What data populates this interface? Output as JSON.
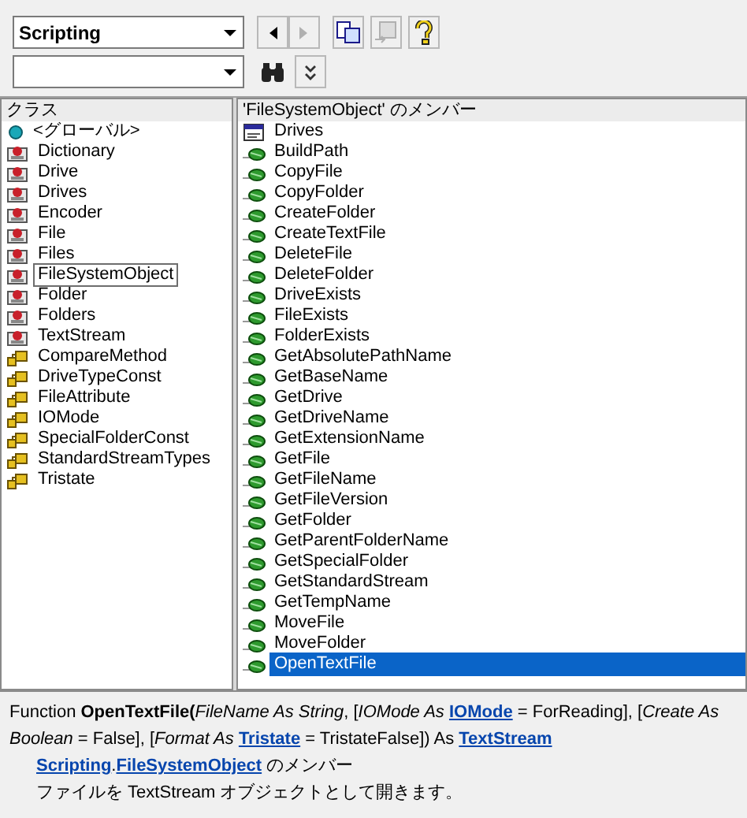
{
  "toolbar": {
    "library": {
      "value": "Scripting"
    },
    "buttons": [
      {
        "kind": "back",
        "disabled": false
      },
      {
        "kind": "forward",
        "disabled": true
      },
      {
        "kind": "copy",
        "disabled": false
      },
      {
        "kind": "definition",
        "disabled": true
      },
      {
        "kind": "help",
        "disabled": false
      }
    ]
  },
  "classes": {
    "header": "クラス",
    "items": [
      {
        "label": "<グローバル>",
        "kind": "global",
        "selected": false
      },
      {
        "label": "Dictionary",
        "kind": "class",
        "selected": false
      },
      {
        "label": "Drive",
        "kind": "class",
        "selected": false
      },
      {
        "label": "Drives",
        "kind": "class",
        "selected": false
      },
      {
        "label": "Encoder",
        "kind": "class",
        "selected": false
      },
      {
        "label": "File",
        "kind": "class",
        "selected": false
      },
      {
        "label": "Files",
        "kind": "class",
        "selected": false
      },
      {
        "label": "FileSystemObject",
        "kind": "class",
        "selected": true
      },
      {
        "label": "Folder",
        "kind": "class",
        "selected": false
      },
      {
        "label": "Folders",
        "kind": "class",
        "selected": false
      },
      {
        "label": "TextStream",
        "kind": "class",
        "selected": false
      },
      {
        "label": "CompareMethod",
        "kind": "enum",
        "selected": false
      },
      {
        "label": "DriveTypeConst",
        "kind": "enum",
        "selected": false
      },
      {
        "label": "FileAttribute",
        "kind": "enum",
        "selected": false
      },
      {
        "label": "IOMode",
        "kind": "enum",
        "selected": false
      },
      {
        "label": "SpecialFolderConst",
        "kind": "enum",
        "selected": false
      },
      {
        "label": "StandardStreamTypes",
        "kind": "enum",
        "selected": false
      },
      {
        "label": "Tristate",
        "kind": "enum",
        "selected": false
      }
    ]
  },
  "members": {
    "header": "'FileSystemObject' のメンバー",
    "items": [
      {
        "label": "Drives",
        "kind": "property",
        "selected": false
      },
      {
        "label": "BuildPath",
        "kind": "method",
        "selected": false
      },
      {
        "label": "CopyFile",
        "kind": "method",
        "selected": false
      },
      {
        "label": "CopyFolder",
        "kind": "method",
        "selected": false
      },
      {
        "label": "CreateFolder",
        "kind": "method",
        "selected": false
      },
      {
        "label": "CreateTextFile",
        "kind": "method",
        "selected": false
      },
      {
        "label": "DeleteFile",
        "kind": "method",
        "selected": false
      },
      {
        "label": "DeleteFolder",
        "kind": "method",
        "selected": false
      },
      {
        "label": "DriveExists",
        "kind": "method",
        "selected": false
      },
      {
        "label": "FileExists",
        "kind": "method",
        "selected": false
      },
      {
        "label": "FolderExists",
        "kind": "method",
        "selected": false
      },
      {
        "label": "GetAbsolutePathName",
        "kind": "method",
        "selected": false
      },
      {
        "label": "GetBaseName",
        "kind": "method",
        "selected": false
      },
      {
        "label": "GetDrive",
        "kind": "method",
        "selected": false
      },
      {
        "label": "GetDriveName",
        "kind": "method",
        "selected": false
      },
      {
        "label": "GetExtensionName",
        "kind": "method",
        "selected": false
      },
      {
        "label": "GetFile",
        "kind": "method",
        "selected": false
      },
      {
        "label": "GetFileName",
        "kind": "method",
        "selected": false
      },
      {
        "label": "GetFileVersion",
        "kind": "method",
        "selected": false
      },
      {
        "label": "GetFolder",
        "kind": "method",
        "selected": false
      },
      {
        "label": "GetParentFolderName",
        "kind": "method",
        "selected": false
      },
      {
        "label": "GetSpecialFolder",
        "kind": "method",
        "selected": false
      },
      {
        "label": "GetStandardStream",
        "kind": "method",
        "selected": false
      },
      {
        "label": "GetTempName",
        "kind": "method",
        "selected": false
      },
      {
        "label": "MoveFile",
        "kind": "method",
        "selected": false
      },
      {
        "label": "MoveFolder",
        "kind": "method",
        "selected": false
      },
      {
        "label": "OpenTextFile",
        "kind": "method",
        "selected": true
      }
    ]
  },
  "details": {
    "signature": [
      {
        "kind": "text",
        "text": "Function **OpenTextFile(**"
      },
      {
        "kind": "text",
        "text": "*FileName As String*, [*IOMode As* "
      },
      {
        "kind": "link",
        "text": "IOMode"
      },
      {
        "kind": "text",
        "text": " = ForReading], [*Create As Boolean* = False], [*Format As* "
      },
      {
        "kind": "link",
        "text": "Tristate"
      },
      {
        "kind": "text",
        "text": " = TristateFalse]) As "
      },
      {
        "kind": "link",
        "text": "TextStream"
      }
    ],
    "member_of": [
      {
        "kind": "link",
        "text": "Scripting"
      },
      {
        "kind": "text",
        "text": "."
      },
      {
        "kind": "link",
        "text": "FileSystemObject"
      },
      {
        "kind": "text",
        "text": " のメンバー"
      }
    ],
    "description": "ファイルを TextStream オブジェクトとして開きます。"
  }
}
